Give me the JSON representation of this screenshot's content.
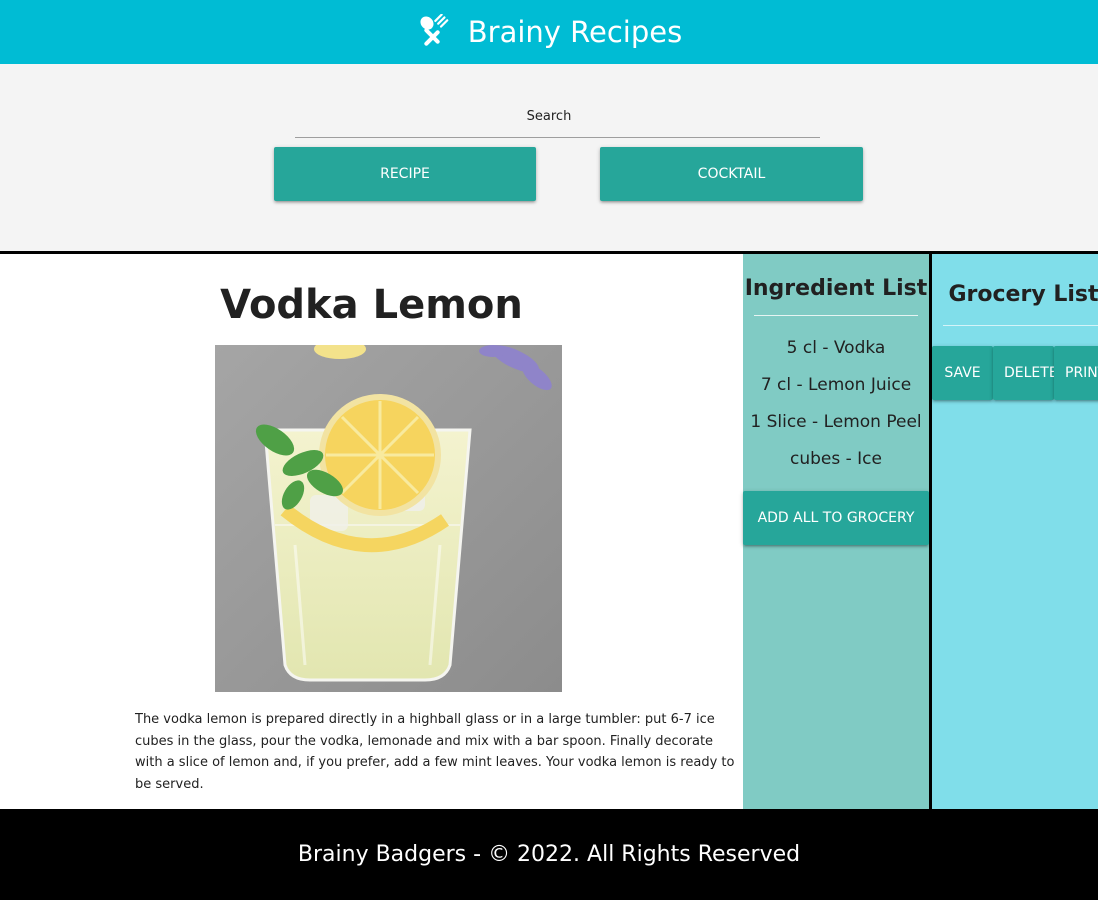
{
  "header": {
    "title": "Brainy Recipes",
    "icon": "utensils-icon",
    "color": "#00bcd4"
  },
  "search": {
    "label": "Search",
    "value": "",
    "placeholder": "",
    "recipe_button": "RECIPE",
    "cocktail_button": "COCKTAIL",
    "button_color": "#26a69a"
  },
  "recipe": {
    "title": "Vodka Lemon",
    "image_alt": "vodka-lemon-drink-image",
    "description": "The vodka lemon is prepared directly in a highball glass or in a large tumbler: put 6-7 ice cubes in the glass, pour the vodka, lemonade and mix with a bar spoon. Finally decorate with a slice of lemon and, if you prefer, add a few mint leaves. Your vodka lemon is ready to be served."
  },
  "ingredients": {
    "title": "Ingredient List",
    "items": [
      "5 cl - Vodka",
      "7 cl - Lemon Juice",
      "1 Slice - Lemon Peel",
      "cubes - Ice"
    ],
    "add_all_button": "ADD ALL TO GROCERY",
    "panel_color": "#80cbc4"
  },
  "grocery": {
    "title": "Grocery List",
    "save_button": "SAVE",
    "delete_button": "DELETE",
    "print_button": "PRINT",
    "panel_color": "#80deea"
  },
  "footer": {
    "text": "Brainy Badgers - © 2022. All Rights Reserved"
  }
}
